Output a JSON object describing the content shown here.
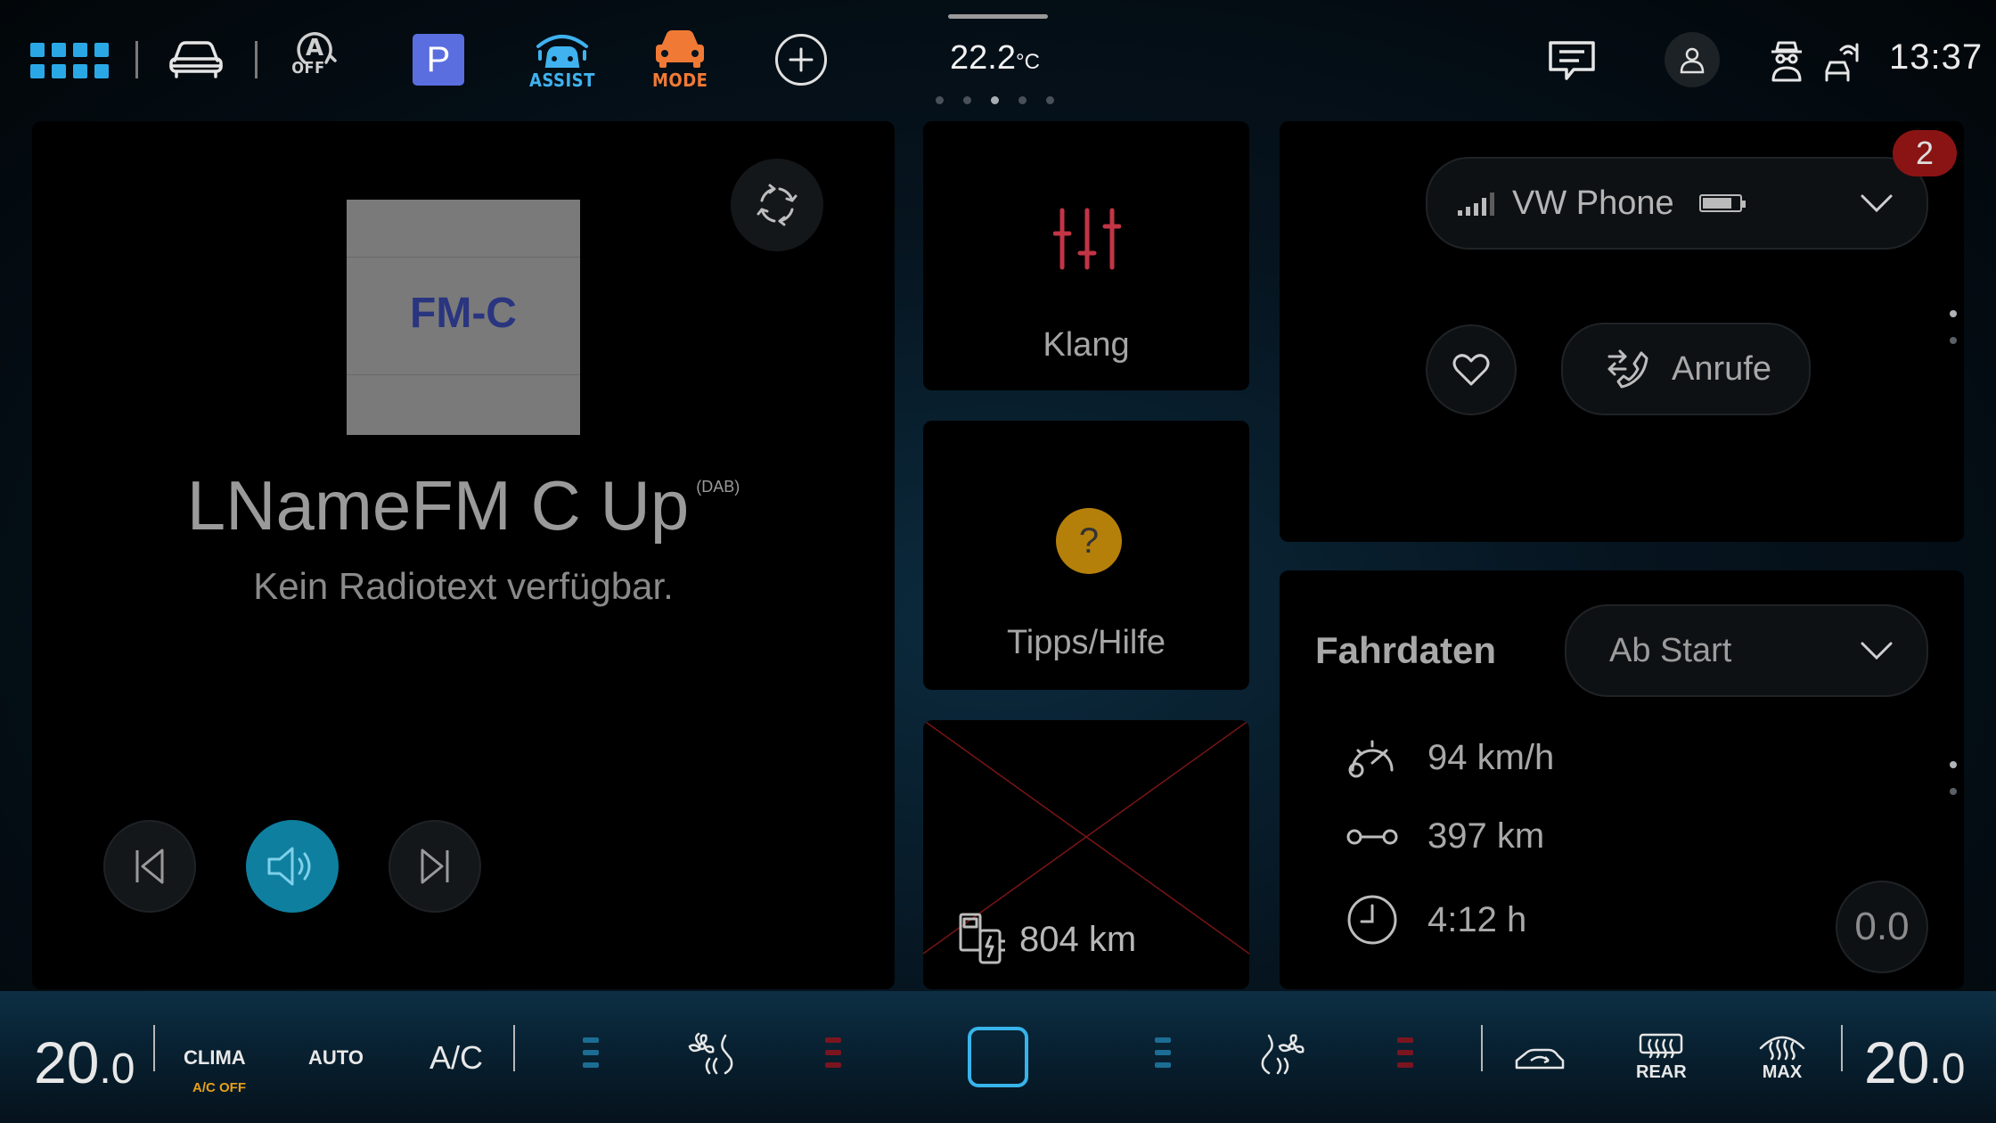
{
  "top_bar": {
    "assist_off_label": "OFF",
    "park_label": "P",
    "assist_label": "ASSIST",
    "mode_label": "MODE",
    "temperature_value": "22.2",
    "temperature_unit": "°C",
    "clock": "13:37",
    "colors": {
      "accent_blue": "#2aa8e6",
      "assist": "#3fb2ef",
      "mode": "#f07a35",
      "park": "#5a6ee0"
    }
  },
  "radio": {
    "cover_text": "FM-C",
    "station_name": "LNameFM C Up",
    "station_source": "(DAB)",
    "radio_text": "Kein Radiotext verfügbar."
  },
  "tiles": {
    "sound_label": "Klang",
    "help_label": "Tipps/Hilfe",
    "help_icon_text": "?",
    "range_value": "804 km"
  },
  "phone": {
    "device_name": "VW Phone",
    "notification_count": "2",
    "calls_label": "Anrufe"
  },
  "trip": {
    "title": "Fahrdaten",
    "filter_value": "Ab Start",
    "avg_speed": "94 km/h",
    "distance": "397 km",
    "duration": "4:12 h",
    "consumption": "0.0"
  },
  "bottom_bar": {
    "left_temp_int": "20",
    "left_temp_dec": ".0",
    "clima_label": "CLIMA",
    "ac_off_label": "A/C OFF",
    "auto_label": "AUTO",
    "ac_label": "A/C",
    "rear_label": "REAR",
    "max_label": "MAX",
    "right_temp_int": "20",
    "right_temp_dec": ".0"
  }
}
